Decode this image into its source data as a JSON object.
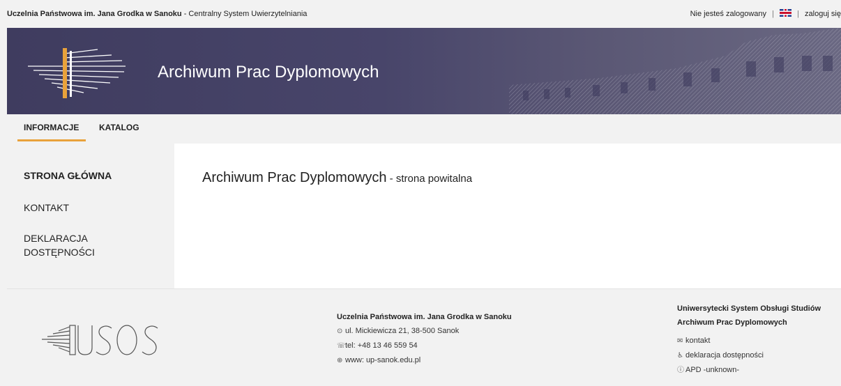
{
  "topbar": {
    "university": "Uczelnia Państwowa im. Jana Grodka w Sanoku",
    "separator": " - ",
    "system": "Centralny System Uwierzytelniania",
    "status": "Nie jesteś zalogowany",
    "divider": "|",
    "login": "zaloguj się"
  },
  "banner": {
    "title": "Archiwum Prac Dyplomowych"
  },
  "nav": {
    "tabs": [
      {
        "label": "INFORMACJE",
        "active": true
      },
      {
        "label": "KATALOG",
        "active": false
      }
    ]
  },
  "sidebar": {
    "items": [
      {
        "label": "STRONA GŁÓWNA",
        "active": true
      },
      {
        "label": "KONTAKT",
        "active": false
      },
      {
        "label": "DEKLARACJA DOSTĘPNOŚCI",
        "active": false
      }
    ]
  },
  "content": {
    "title": "Archiwum Prac Dyplomowych",
    "subtitle": " - strona powitalna"
  },
  "footer": {
    "uni_name": "Uczelnia Państwowa im. Jana Grodka w Sanoku",
    "address": "ul. Mickiewicza 21, 38-500 Sanok",
    "phone": "tel: +48 13 46 559 54",
    "www": "www: up-sanok.edu.pl",
    "system_name": "Uniwersytecki System Obsługi Studiów",
    "app_name": "Archiwum Prac Dyplomowych",
    "contact": "kontakt",
    "accessibility": "deklaracja dostępności",
    "version": "APD -unknown-"
  },
  "colors": {
    "banner": "#46436a",
    "accent": "#e9a23b",
    "background": "#f2f2f2"
  },
  "icons": [
    "uk-flag-icon",
    "location-icon",
    "phone-icon",
    "globe-icon",
    "mail-icon",
    "accessibility-icon",
    "info-icon"
  ]
}
